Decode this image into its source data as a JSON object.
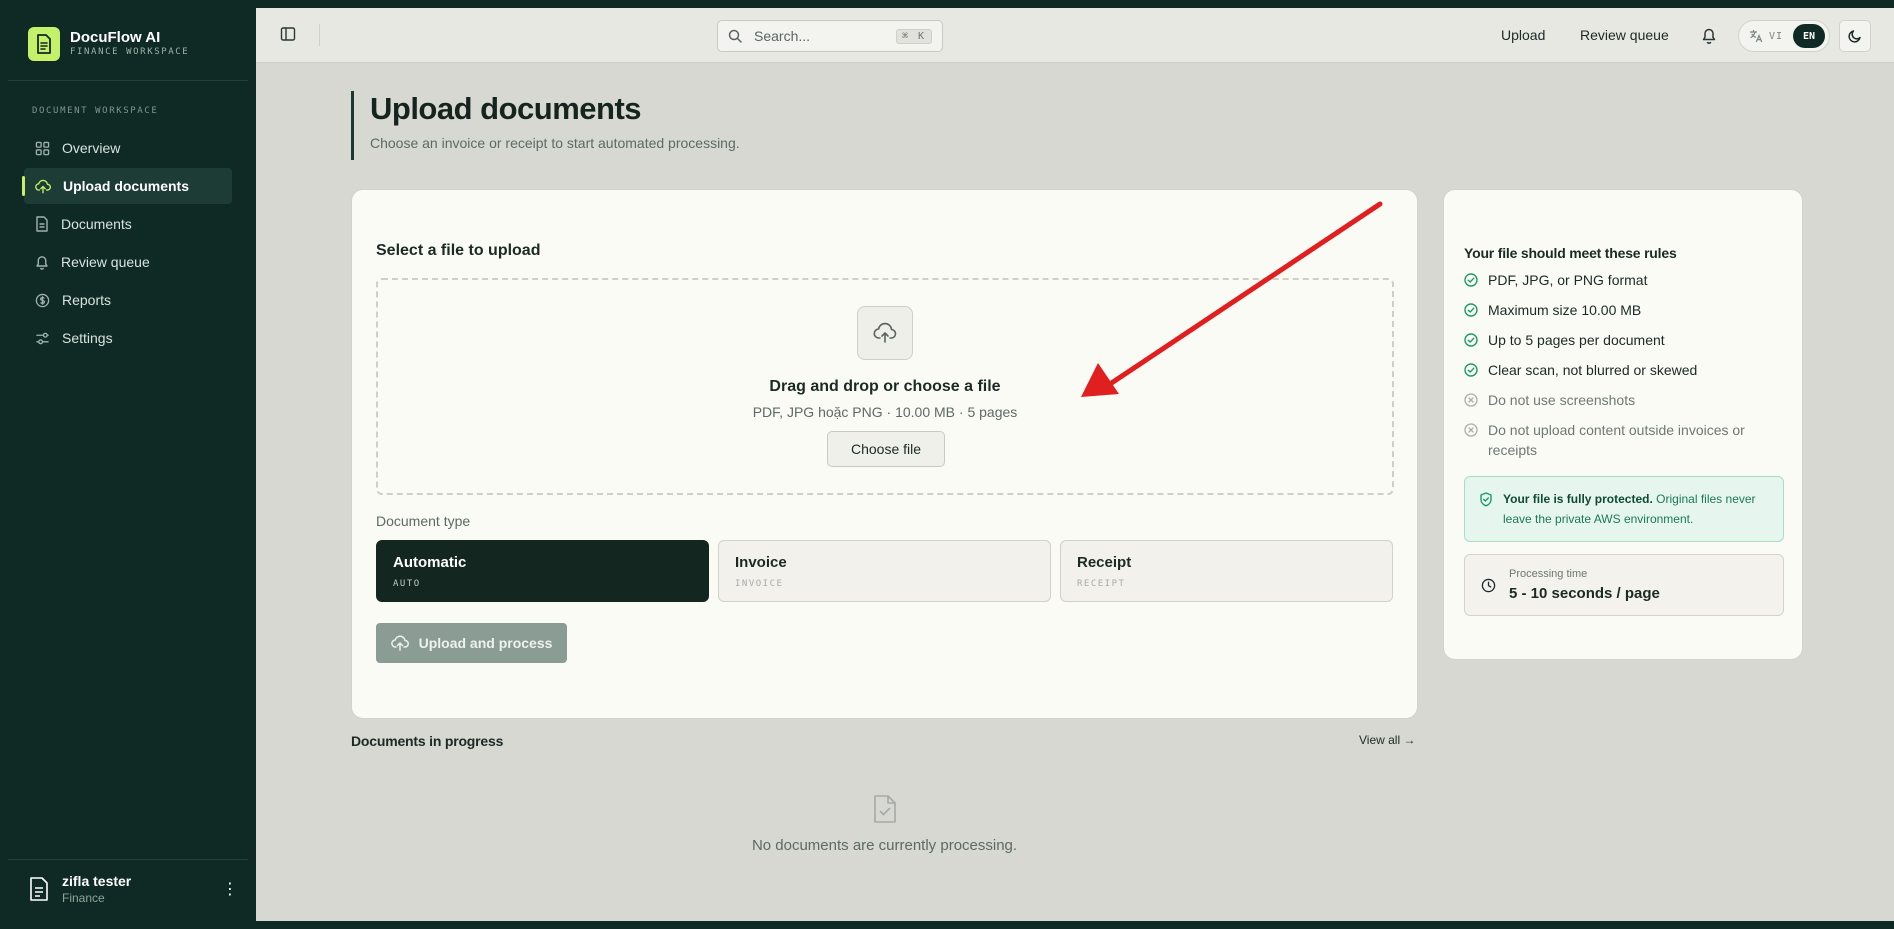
{
  "app": {
    "name": "DocuFlow AI",
    "subtitle": "FINANCE WORKSPACE"
  },
  "sidebar": {
    "section_label": "DOCUMENT WORKSPACE",
    "items": [
      {
        "label": "Overview",
        "icon": "grid-icon",
        "active": false
      },
      {
        "label": "Upload documents",
        "icon": "cloud-upload-icon",
        "active": true
      },
      {
        "label": "Documents",
        "icon": "document-icon",
        "active": false
      },
      {
        "label": "Review queue",
        "icon": "bell-icon",
        "active": false
      },
      {
        "label": "Reports",
        "icon": "dollar-icon",
        "active": false
      },
      {
        "label": "Settings",
        "icon": "sliders-icon",
        "active": false
      }
    ],
    "user": {
      "name": "zifla tester",
      "role": "Finance",
      "menu_glyph": "⋮"
    }
  },
  "topbar": {
    "search_placeholder": "Search...",
    "search_shortcut": "⌘ K",
    "links": {
      "upload": "Upload",
      "review_queue": "Review queue"
    },
    "lang": {
      "alt": "VI",
      "current": "EN"
    }
  },
  "page": {
    "title": "Upload documents",
    "subtitle": "Choose an invoice or receipt to start automated processing."
  },
  "upload": {
    "section_title": "Select a file to upload",
    "dropzone_title": "Drag and drop or choose a file",
    "dropzone_sub": "PDF, JPG hoặc PNG · 10.00 MB · 5 pages",
    "choose_label": "Choose file",
    "doc_type_label": "Document type",
    "types": [
      {
        "name": "Automatic",
        "code": "AUTO",
        "selected": true
      },
      {
        "name": "Invoice",
        "code": "INVOICE",
        "selected": false
      },
      {
        "name": "Receipt",
        "code": "RECEIPT",
        "selected": false
      }
    ],
    "submit_label": "Upload and process"
  },
  "rules": {
    "title": "Your file should meet these rules",
    "items": [
      {
        "text": "PDF, JPG, or PNG format",
        "ok": true
      },
      {
        "text": "Maximum size 10.00 MB",
        "ok": true
      },
      {
        "text": "Up to 5 pages per document",
        "ok": true
      },
      {
        "text": "Clear scan, not blurred or skewed",
        "ok": true
      },
      {
        "text": "Do not use screenshots",
        "ok": false
      },
      {
        "text": "Do not upload content outside invoices or receipts",
        "ok": false
      }
    ],
    "protect_bold": "Your file is fully protected.",
    "protect_text": "Original files never leave the private AWS environment.",
    "processing_label": "Processing time",
    "processing_value": "5 - 10 seconds / page"
  },
  "progress": {
    "title": "Documents in progress",
    "view_all": "View all →",
    "empty_text": "No documents are currently processing."
  },
  "colors": {
    "sidebar_bg": "#0f2a24",
    "accent": "#c5f06a",
    "success": "#1c9a6c",
    "annotation_arrow": "#e02020"
  }
}
